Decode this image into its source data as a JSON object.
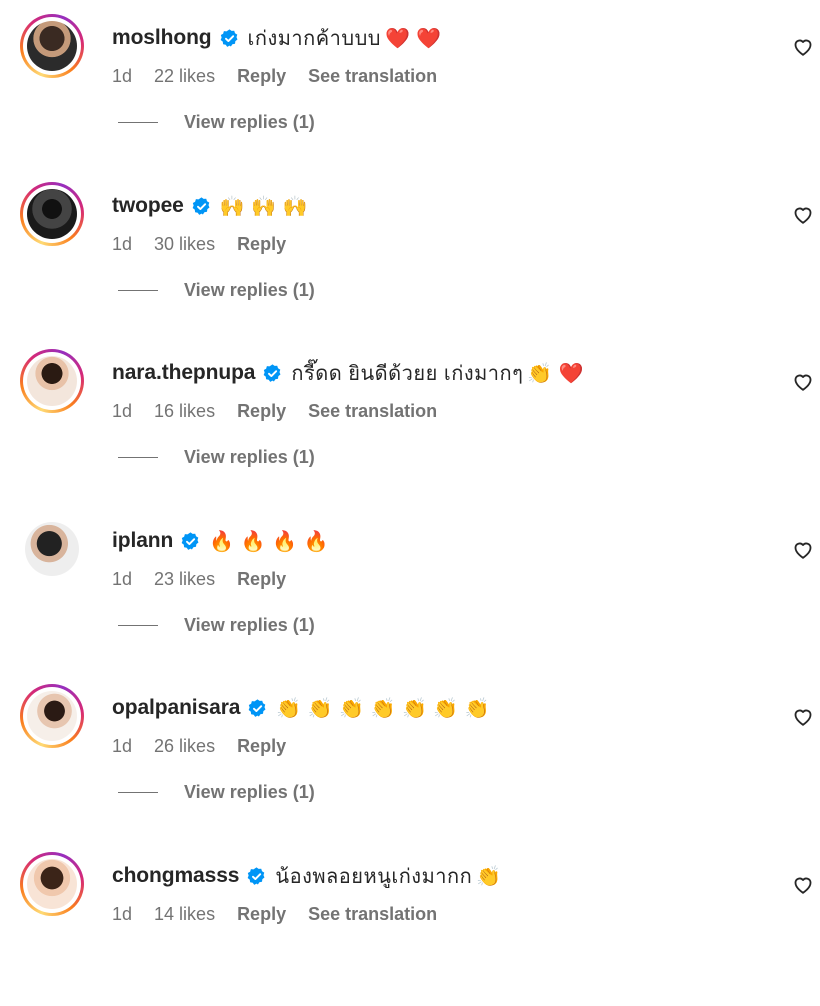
{
  "colors": {
    "text": "#262626",
    "meta": "#737373",
    "verified": "#0095f6",
    "background": "#ffffff"
  },
  "comments": [
    {
      "username": "moslhong",
      "text": "เก่งมากค้าบบบ",
      "emojis": [
        "❤️",
        "❤️"
      ],
      "time": "1d",
      "likes": "22 likes",
      "reply": "Reply",
      "translation": "See translation",
      "view_replies": "View replies (1)"
    },
    {
      "username": "twopee",
      "text": "",
      "emojis": [
        "🙌",
        "🙌",
        "🙌"
      ],
      "time": "1d",
      "likes": "30 likes",
      "reply": "Reply",
      "view_replies": "View replies (1)"
    },
    {
      "username": "nara.thepnupa",
      "text": "กรี๊ดด ยินดีด้วยย เก่งมากๆ",
      "emojis": [
        "👏",
        "❤️"
      ],
      "time": "1d",
      "likes": "16 likes",
      "reply": "Reply",
      "translation": "See translation",
      "view_replies": "View replies (1)"
    },
    {
      "username": "iplann",
      "text": "",
      "emojis": [
        "🔥",
        "🔥",
        "🔥",
        "🔥"
      ],
      "time": "1d",
      "likes": "23 likes",
      "reply": "Reply",
      "view_replies": "View replies (1)"
    },
    {
      "username": "opalpanisara",
      "text": "",
      "emojis": [
        "👏",
        "👏",
        "👏",
        "👏",
        "👏",
        "👏",
        "👏"
      ],
      "time": "1d",
      "likes": "26 likes",
      "reply": "Reply",
      "view_replies": "View replies (1)"
    },
    {
      "username": "chongmasss",
      "text": "น้องพลอยหนูเก่งมากก",
      "emojis": [
        "👏"
      ],
      "time": "1d",
      "likes": "14 likes",
      "reply": "Reply",
      "translation": "See translation"
    }
  ],
  "icons": {
    "verified": "verified-badge-icon",
    "like": "heart-outline-icon"
  }
}
